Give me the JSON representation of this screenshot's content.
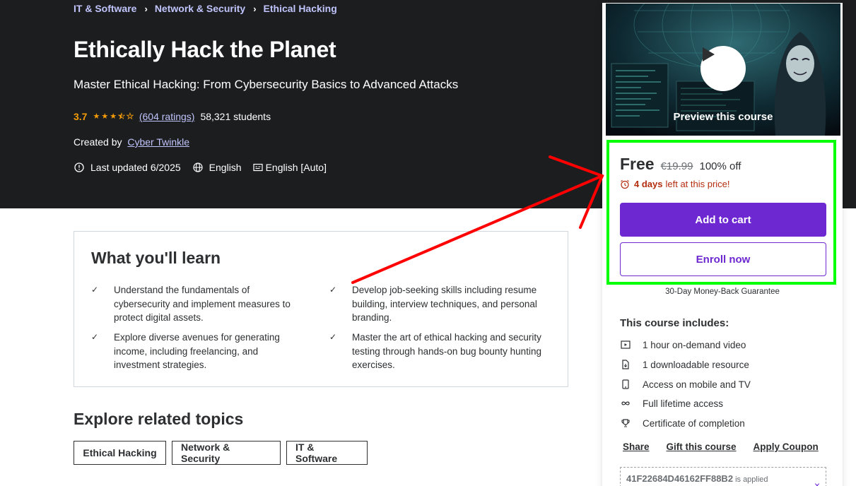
{
  "breadcrumb": {
    "items": [
      "IT & Software",
      "Network & Security",
      "Ethical Hacking"
    ],
    "separator": "›"
  },
  "course": {
    "title": "Ethically Hack the Planet",
    "subtitle": "Master Ethical Hacking: From Cybersecurity Basics to Advanced Attacks",
    "rating": "3.7",
    "rating_value": 3.7,
    "ratings_link": "(604 ratings)",
    "students": "58,321 students",
    "created_by_label": "Created by",
    "author": "Cyber Twinkle",
    "last_updated": "Last updated 6/2025",
    "language": "English",
    "captions": "English [Auto]"
  },
  "learn": {
    "title": "What you'll learn",
    "items": [
      "Understand the fundamentals of cybersecurity and implement measures to protect digital assets.",
      "Develop job-seeking skills including resume building, interview techniques, and personal branding.",
      "Explore diverse avenues for generating income, including freelancing, and investment strategies.",
      "Master the art of ethical hacking and security testing through hands-on bug bounty hunting exercises."
    ]
  },
  "topics": {
    "title": "Explore related topics",
    "items": [
      "Ethical Hacking",
      "Network & Security",
      "IT & Software"
    ]
  },
  "sidebar": {
    "preview_label": "Preview this course",
    "price": "Free",
    "original_price": "€19.99",
    "discount": "100% off",
    "timer_days": "4 days",
    "timer_rest": "left at this price!",
    "add_to_cart": "Add to cart",
    "enroll": "Enroll now",
    "guarantee": "30-Day Money-Back Guarantee",
    "includes_title": "This course includes:",
    "includes": [
      {
        "icon": "video-icon",
        "text": "1 hour on-demand video"
      },
      {
        "icon": "file-download-icon",
        "text": "1 downloadable resource"
      },
      {
        "icon": "mobile-icon",
        "text": "Access on mobile and TV"
      },
      {
        "icon": "infinity-icon",
        "text": "Full lifetime access"
      },
      {
        "icon": "trophy-icon",
        "text": "Certificate of completion"
      }
    ],
    "actions": [
      "Share",
      "Gift this course",
      "Apply Coupon"
    ],
    "coupon_code": "41F22684D46162FF88B2",
    "coupon_applied": "is applied",
    "coupon_close": "×"
  },
  "colors": {
    "hero_bg": "#1c1d1f",
    "accent_purple": "#6d28d2",
    "link_lavender": "#c0c4fc",
    "star_orange": "#f69c08",
    "timer_red": "#b32d0f",
    "annotation_green": "#00ff00",
    "annotation_red": "#ff0000"
  }
}
